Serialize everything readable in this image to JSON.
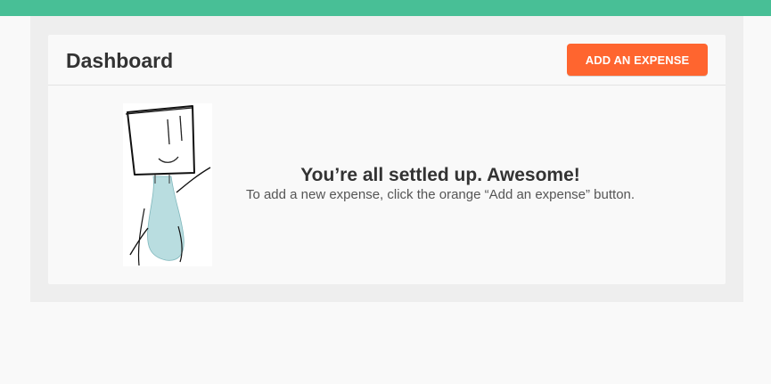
{
  "colors": {
    "top_bar": "#48bf96",
    "accent_button": "#ff652f"
  },
  "header": {
    "title": "Dashboard",
    "add_expense_label": "ADD AN EXPENSE"
  },
  "illustration": {
    "icon": "person-with-bag-illustration"
  },
  "empty_state": {
    "title": "You’re all settled up. Awesome!",
    "description": "To add a new expense, click the orange “Add an expense” button."
  }
}
